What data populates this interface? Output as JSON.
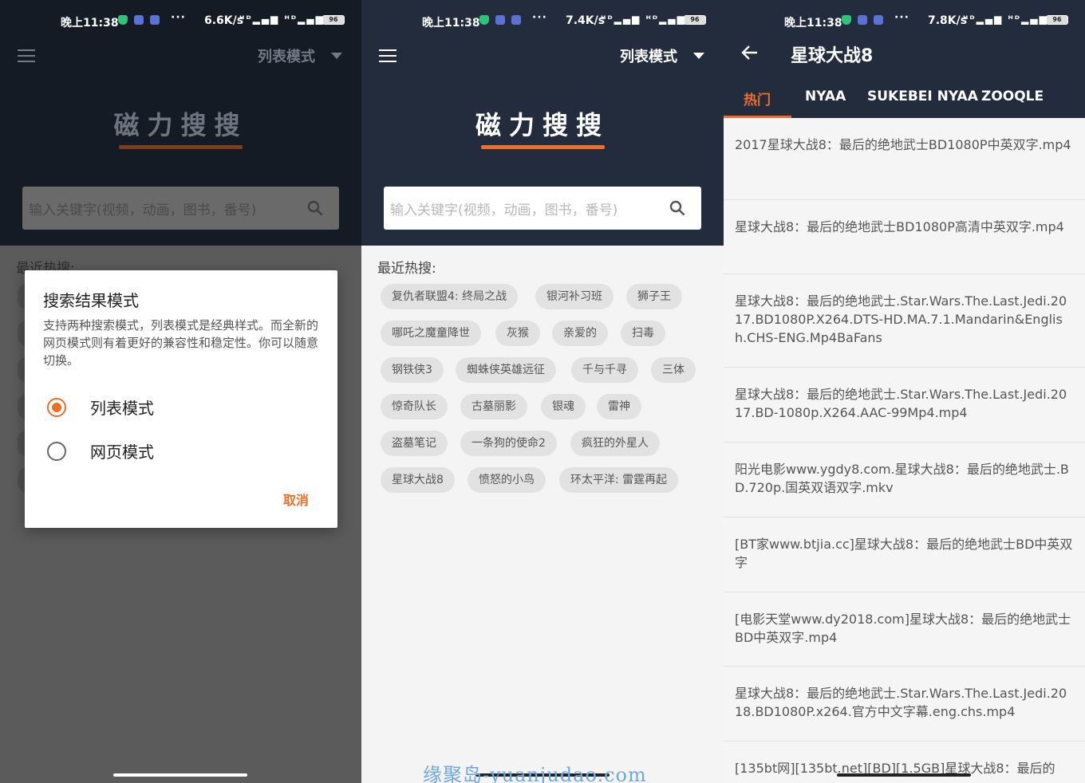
{
  "status_bar": [
    {
      "time": "晚上11:38",
      "speed": "6.6K/s",
      "battery": "96"
    },
    {
      "time": "晚上11:38",
      "speed": "7.4K/s",
      "battery": "96"
    },
    {
      "time": "晚上11:38",
      "speed": "7.8K/s",
      "battery": "96"
    }
  ],
  "status_icons_text": "ᵸᴰ▂▄▆ ᵸᴰ▂▄▆",
  "dots": "···",
  "home": {
    "mode_label": "列表模式",
    "logo": "磁力搜搜",
    "search_placeholder": "输入关键字(视频，动画，图书，番号)",
    "recent_label": "最近热搜:",
    "tags": [
      "复仇者联盟4: 终局之战",
      "银河补习班",
      "狮子王",
      "哪吒之魔童降世",
      "灰猴",
      "亲爱的",
      "扫毒",
      "钢铁侠3",
      "蜘蛛侠英雄远征",
      "千与千寻",
      "三体",
      "惊奇队长",
      "古墓丽影",
      "银魂",
      "雷神",
      "盗墓笔记",
      "一条狗的使命2",
      "疯狂的外星人",
      "星球大战8",
      "愤怒的小鸟",
      "环太平洋: 雷霆再起"
    ]
  },
  "dialog": {
    "title": "搜索结果模式",
    "description": "支持两种搜索模式，列表模式是经典样式。而全新的网页模式则有着更好的兼容性和稳定性。你可以随意切换。",
    "options": [
      {
        "label": "列表模式",
        "selected": true
      },
      {
        "label": "网页模式",
        "selected": false
      }
    ],
    "cancel": "取消"
  },
  "results_page": {
    "title": "星球大战8",
    "tabs": [
      "热门",
      "NYAA",
      "SUKEBEI NYAA",
      "ZOOQLE"
    ],
    "active_tab": 0,
    "results": [
      "2017星球大战8：最后的绝地武士BD1080P中英双字.mp4",
      "星球大战8：最后的绝地武士BD1080P高清中英双字.mp4",
      "星球大战8：最后的绝地武士.Star.Wars.The.Last.Jedi.2017.BD1080P.X264.DTS-HD.MA.7.1.Mandarin&English.CHS-ENG.Mp4BaFans",
      "星球大战8：最后的绝地武士.Star.Wars.The.Last.Jedi.2017.BD-1080p.X264.AAC-99Mp4.mp4",
      "阳光电影www.ygdy8.com.星球大战8：最后的绝地武士.BD.720p.国英双语双字.mkv",
      "[BT家www.btjia.cc]星球大战8：最后的绝地武士BD中英双字",
      "[电影天堂www.dy2018.com]星球大战8：最后的绝地武士BD中英双字.mp4",
      "星球大战8：最后的绝地武士.Star.Wars.The.Last.Jedi.2018.BD1080P.x264.官方中文字幕.eng.chs.mp4",
      "[135bt网][135bt.net][BD][1.5GB]星球大战8：最后的"
    ]
  },
  "watermark": "缘聚岛-yuanjudao.com",
  "colors": {
    "accent": "#ee6d29",
    "header": "#222c3d",
    "tag_bg": "#e2e2e2"
  }
}
